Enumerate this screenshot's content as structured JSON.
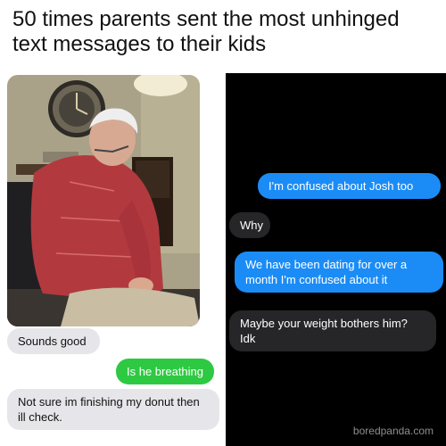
{
  "headline": "50 times parents sent the most unhinged text messages to their kids",
  "left_conversation": {
    "messages": [
      {
        "sender": "other",
        "text": "Sounds good"
      },
      {
        "sender": "me",
        "text": "Is he breathing"
      },
      {
        "sender": "other",
        "text": "Not sure im finishing my donut then ill check."
      }
    ]
  },
  "right_conversation": {
    "messages": [
      {
        "sender": "me",
        "text": "I'm confused about Josh too"
      },
      {
        "sender": "other",
        "text": "Why"
      },
      {
        "sender": "me",
        "text": "We have been dating for over a month I'm confused about it"
      },
      {
        "sender": "other",
        "text": "Maybe your weight bothers him? Idk"
      }
    ]
  },
  "watermark": "boredpanda.com",
  "colors": {
    "sent_green": "#2ec942",
    "sent_blue": "#1b8cf6",
    "received_light": "#e6e6ea",
    "received_dark": "#262628",
    "dark_background": "#000000"
  }
}
